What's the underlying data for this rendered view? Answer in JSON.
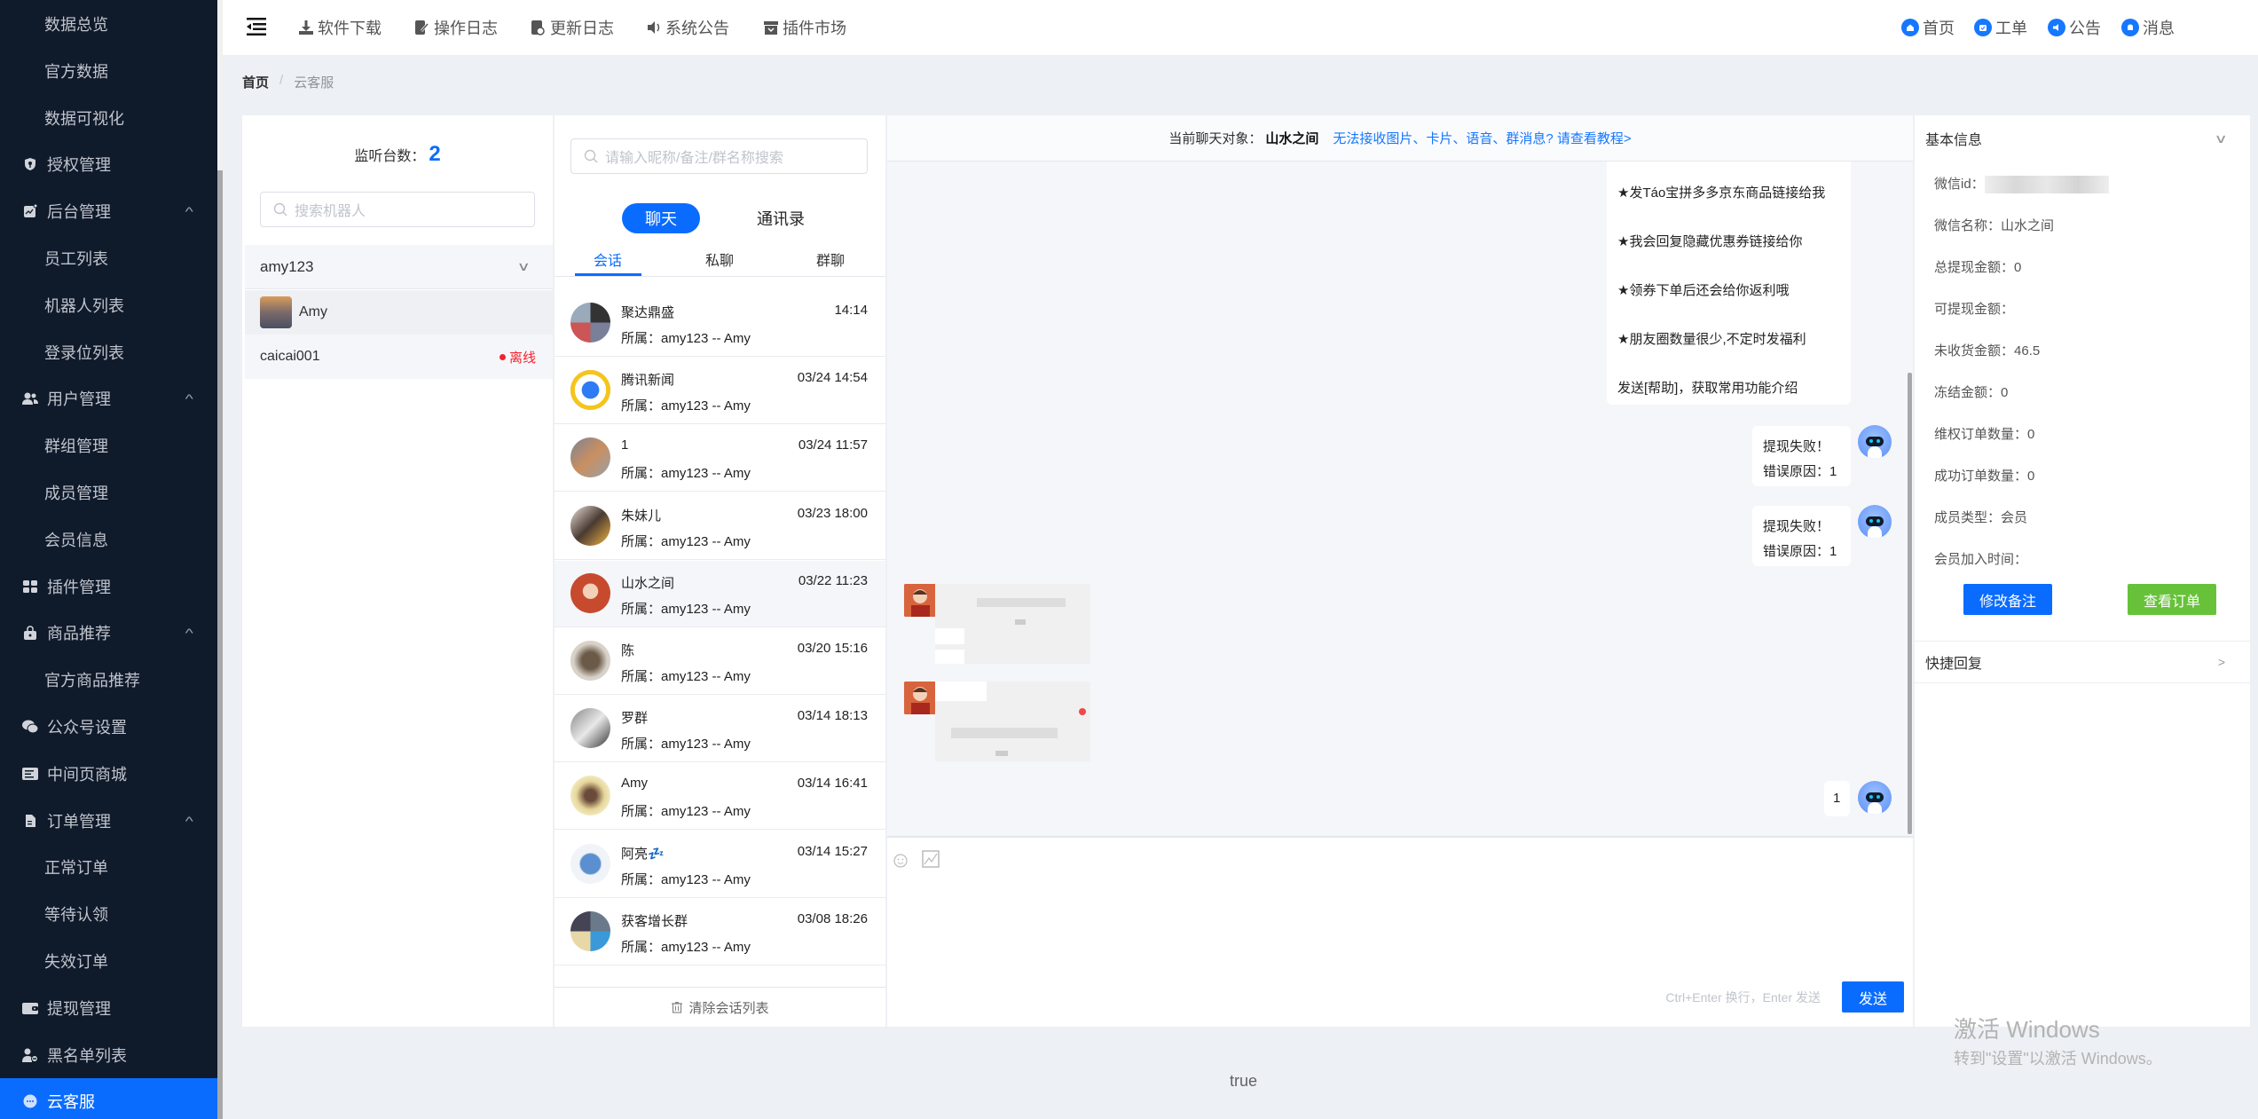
{
  "sidebar": {
    "items": [
      {
        "label": "数据总览",
        "type": "sub"
      },
      {
        "label": "官方数据",
        "type": "sub"
      },
      {
        "label": "数据可视化",
        "type": "sub"
      },
      {
        "label": "授权管理",
        "type": "group",
        "icon": "shield-key-icon"
      },
      {
        "label": "后台管理",
        "type": "group",
        "icon": "chart-icon",
        "expanded": true
      },
      {
        "label": "员工列表",
        "type": "sub"
      },
      {
        "label": "机器人列表",
        "type": "sub"
      },
      {
        "label": "登录位列表",
        "type": "sub"
      },
      {
        "label": "用户管理",
        "type": "group",
        "icon": "users-icon",
        "expanded": true
      },
      {
        "label": "群组管理",
        "type": "sub"
      },
      {
        "label": "成员管理",
        "type": "sub"
      },
      {
        "label": "会员信息",
        "type": "sub"
      },
      {
        "label": "插件管理",
        "type": "group",
        "icon": "grid-icon"
      },
      {
        "label": "商品推荐",
        "type": "group",
        "icon": "bag-icon",
        "expanded": true
      },
      {
        "label": "官方商品推荐",
        "type": "sub"
      },
      {
        "label": "公众号设置",
        "type": "group",
        "icon": "wechat-icon"
      },
      {
        "label": "中间页商城",
        "type": "group",
        "icon": "store-icon"
      },
      {
        "label": "订单管理",
        "type": "group",
        "icon": "document-icon",
        "expanded": true
      },
      {
        "label": "正常订单",
        "type": "sub"
      },
      {
        "label": "等待认领",
        "type": "sub"
      },
      {
        "label": "失效订单",
        "type": "sub"
      },
      {
        "label": "提现管理",
        "type": "group",
        "icon": "wallet-icon"
      },
      {
        "label": "黑名单列表",
        "type": "group",
        "icon": "user-block-icon"
      },
      {
        "label": "云客服",
        "type": "group",
        "icon": "chat-bubble-icon",
        "active": true
      }
    ]
  },
  "header": {
    "tools": [
      {
        "label": "软件下载",
        "icon": "download-icon"
      },
      {
        "label": "操作日志",
        "icon": "edit-log-icon"
      },
      {
        "label": "更新日志",
        "icon": "update-log-icon"
      },
      {
        "label": "系统公告",
        "icon": "speaker-icon"
      },
      {
        "label": "插件市场",
        "icon": "shop-icon"
      }
    ],
    "right": [
      {
        "label": "首页",
        "icon": "home-icon"
      },
      {
        "label": "工单",
        "icon": "ticket-icon"
      },
      {
        "label": "公告",
        "icon": "megaphone-icon"
      },
      {
        "label": "消息",
        "icon": "bell-icon"
      }
    ],
    "accent": "#0a6cff"
  },
  "breadcrumb": {
    "home": "首页",
    "sep": "/",
    "current": "云客服"
  },
  "robots": {
    "monitor_label": "监听台数：",
    "monitor_count": "2",
    "search_placeholder": "搜索机器人",
    "group": "amy123",
    "rows": [
      {
        "name": "Amy",
        "status": ""
      },
      {
        "name": "caicai001",
        "status": "离线"
      }
    ]
  },
  "conversations": {
    "search_placeholder": "请输入昵称/备注/群名称搜索",
    "seg_chat": "聊天",
    "seg_contacts": "通讯录",
    "tabs": [
      "会话",
      "私聊",
      "群聊"
    ],
    "items": [
      {
        "name": "聚达鼎盛",
        "time": "14:14",
        "owner": "所属：amy123 -- Amy"
      },
      {
        "name": "腾讯新闻",
        "time": "03/24 14:54",
        "owner": "所属：amy123 -- Amy"
      },
      {
        "name": "1",
        "time": "03/24 11:57",
        "owner": "所属：amy123 -- Amy"
      },
      {
        "name": "朱妹儿",
        "time": "03/23 18:00",
        "owner": "所属：amy123 -- Amy"
      },
      {
        "name": "山水之间",
        "time": "03/22 11:23",
        "owner": "所属：amy123 -- Amy",
        "selected": true
      },
      {
        "name": "陈",
        "time": "03/20 15:16",
        "owner": "所属：amy123 -- Amy"
      },
      {
        "name": "罗群",
        "time": "03/14 18:13",
        "owner": "所属：amy123 -- Amy"
      },
      {
        "name": "Amy",
        "time": "03/14 16:41",
        "owner": "所属：amy123 -- Amy"
      },
      {
        "name": "阿亮💤",
        "time": "03/14 15:27",
        "owner": "所属：amy123 -- Amy"
      },
      {
        "name": "获客增长群",
        "time": "03/08 18:26",
        "owner": "所属：amy123 -- Amy"
      }
    ],
    "clear_label": "清除会话列表"
  },
  "chat": {
    "head_label": "当前聊天对象：",
    "target": "山水之间",
    "help_link": "无法接收图片、卡片、语音、群消息? 请查看教程>",
    "intro_lines": [
      "★发Táo宝拼多多京东商品链接给我",
      "★我会回复隐藏优惠券链接给你",
      "★领券下单后还会给你返利哦",
      "★朋友圈数量很少,不定时发福利",
      "发送[帮助]，获取常用功能介绍"
    ],
    "out_messages": [
      {
        "line1": "提现失败！",
        "line2": "错误原因：1"
      },
      {
        "line1": "提现失败！",
        "line2": "错误原因：1"
      }
    ],
    "last_message": "1",
    "hint": "Ctrl+Enter 换行，Enter 发送",
    "send_label": "发送"
  },
  "info": {
    "title": "基本信息",
    "rows": [
      {
        "label": "微信id：",
        "value": ""
      },
      {
        "label": "微信名称：",
        "value": "山水之间"
      },
      {
        "label": "总提现金额：",
        "value": "0"
      },
      {
        "label": "可提现金额：",
        "value": ""
      },
      {
        "label": "未收货金额：",
        "value": "46.5"
      },
      {
        "label": "冻结金额：",
        "value": "0"
      },
      {
        "label": "维权订单数量：",
        "value": "0"
      },
      {
        "label": "成功订单数量：",
        "value": "0"
      },
      {
        "label": "成员类型：",
        "value": "会员"
      },
      {
        "label": "会员加入时间：",
        "value": ""
      }
    ],
    "edit_note": "修改备注",
    "view_orders": "查看订单",
    "quick_reply": "快捷回复",
    "primary_color": "#0a6cff",
    "success_color": "#67c23a"
  },
  "footer_text": "true",
  "watermark": {
    "line1": "激活 Windows",
    "line2": "转到\"设置\"以激活 Windows。"
  }
}
